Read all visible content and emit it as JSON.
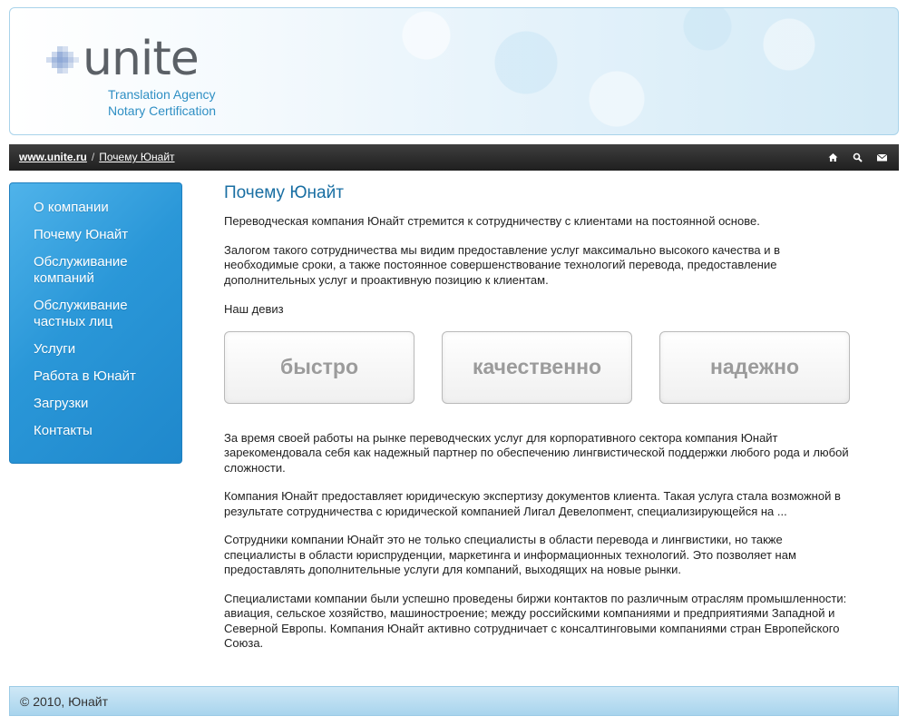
{
  "header": {
    "logo_word": "unite",
    "logo_sub_1": "Translation Agency",
    "logo_sub_2": "Notary Certification"
  },
  "breadcrumb": {
    "home": "www.unite.ru",
    "separator": "/",
    "current": "Почему Юнайт"
  },
  "tools": {
    "icons": [
      "home-icon",
      "search-icon",
      "mail-icon"
    ]
  },
  "sidebar": {
    "items": [
      {
        "label": "О компании"
      },
      {
        "label": "Почему Юнайт"
      },
      {
        "label": "Обслуживание компаний"
      },
      {
        "label": "Обслуживание частных лиц"
      },
      {
        "label": "Услуги"
      },
      {
        "label": "Работа в Юнайт"
      },
      {
        "label": "Загрузки"
      },
      {
        "label": "Контакты"
      }
    ]
  },
  "main": {
    "title": "Почему Юнайт",
    "p1": "Переводческая компания Юнайт стремится к сотрудничеству с клиентами на постоянной основе.",
    "p2": "Залогом такого сотрудничества мы видим предоставление услуг максимально высокого качества и в необходимые сроки, а также постоянное совершенствование технологий перевода, предоставление дополнительных услуг и проактивную позицию к клиентам.",
    "motto_label": "Наш девиз",
    "mottos": [
      "быстро",
      "качественно",
      "надежно"
    ],
    "p3": "За  время своей работы на рынке переводческих услуг для корпоративного сектора компания Юнайт зарекомендовала себя как надежный партнер по обеспечению лингвистической поддержки любого рода и любой сложности.",
    "p4": "Компания  Юнайт предоставляет юридическую экспертизу документов клиента. Такая услуга стала возможной в результате сотрудничества с юридической компанией Лигал Девелопмент, специализирующейся на ...",
    "p5": "Сотрудники  компании Юнайт это не только специалисты  в области перевода и лингвистики, но также специалисты в области юриспруденции, маркетинга и информационных технологий. Это позволяет нам предоставлять дополнительные услуги для компаний, выходящих на новые рынки.",
    "p6": "Специалистами компании были успешно проведены биржи контактов по различным отраслям промышленности: авиация, сельское хозяйство, машиностроение; между российскими компаниями и предприятиями Западной и Северной Европы. Компания Юнайт активно сотрудничает с консалтинговыми компаниями стран Европейского Союза."
  },
  "footer": {
    "copyright": "© 2010, Юнайт"
  },
  "colors": {
    "accent": "#2a97d8",
    "title": "#1a6fa3",
    "topbar": "#2b2b2b",
    "motto_text": "#9b9b9b"
  }
}
